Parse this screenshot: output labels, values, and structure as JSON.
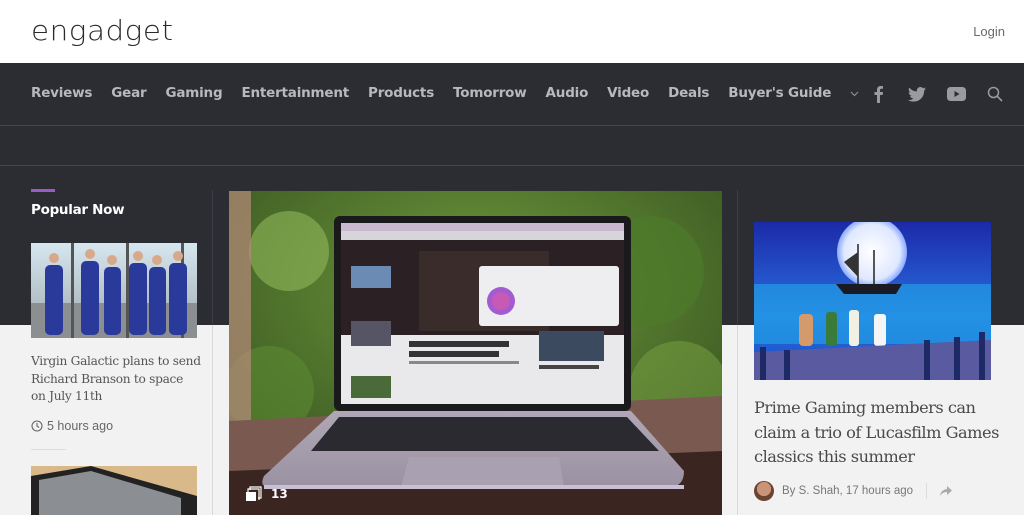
{
  "header": {
    "logo": "engadget",
    "login_label": "Login"
  },
  "nav": {
    "items": [
      "Reviews",
      "Gear",
      "Gaming",
      "Entertainment",
      "Products",
      "Tomorrow",
      "Audio",
      "Video",
      "Deals",
      "Buyer's Guide"
    ],
    "dropdown_icon": "chevron-down-icon",
    "social_icons": [
      "facebook-icon",
      "twitter-icon",
      "youtube-icon",
      "search-icon"
    ]
  },
  "popular": {
    "title": "Popular Now",
    "accent_color": "#9b59c9",
    "items": [
      {
        "headline": "Virgin Galactic plans to send Richard Branson to space on July 11th",
        "time": "5 hours ago",
        "image": "astronaut-crew-photo"
      },
      {
        "image": "handheld-device-photo"
      }
    ]
  },
  "hero": {
    "image": "macbook-air-on-table-photo",
    "gallery_count": "13"
  },
  "right_story": {
    "image": "monkey-island-pirate-ship-art",
    "headline": "Prime Gaming members can claim a trio of Lucasfilm Games classics this summer",
    "byline": "By S. Shah, 17 hours ago"
  },
  "colors": {
    "dark_bg": "#2c2d33",
    "light_bg": "#f2f2f2",
    "nav_text": "#b9b9bd"
  }
}
